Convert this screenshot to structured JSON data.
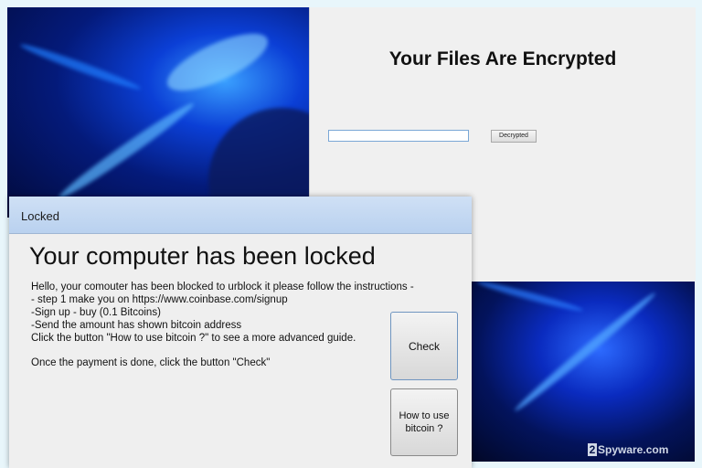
{
  "encrypted_window": {
    "title": "Your Files Are Encrypted",
    "input_value": "",
    "button_label": "Decrypted"
  },
  "locked_window": {
    "titlebar": "Locked",
    "heading": "Your computer has been locked",
    "body_lines": [
      "Hello, your comouter has been blocked to urblock it please follow the instructions -",
      "- step 1 make you on https://www.coinbase.com/signup",
      "-Sign up - buy (0.1 Bitcoins)",
      "-Send the amount has shown bitcoin address",
      "Click the button \"How to use bitcoin ?\" to see a more advanced guide.",
      "Once the payment is done, click the button \"Check\""
    ],
    "check_button": "Check",
    "howto_button_line1": "How to use",
    "howto_button_line2": "bitcoin ?"
  },
  "watermark": {
    "prefix": "2",
    "text": "Spyware.com"
  }
}
